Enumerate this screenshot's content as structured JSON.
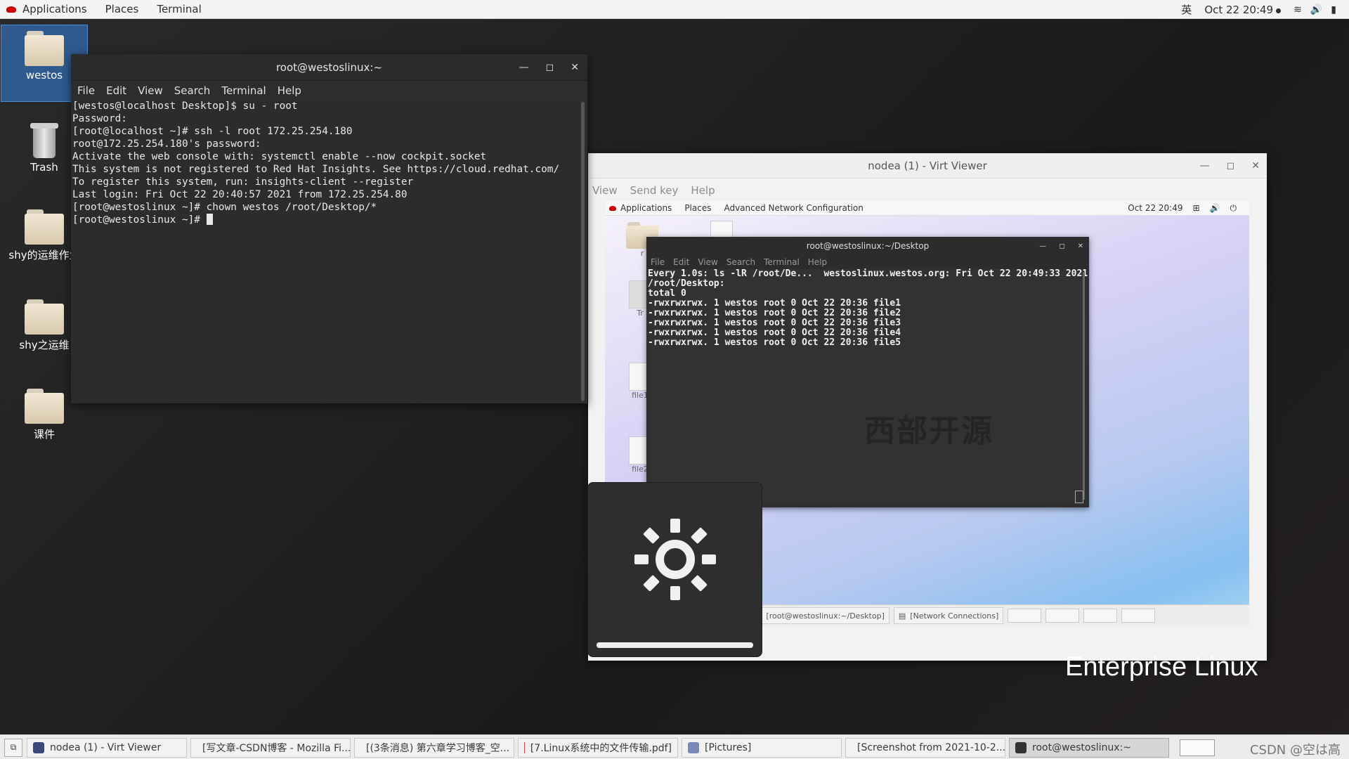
{
  "topbar": {
    "applications": "Applications",
    "places": "Places",
    "terminal": "Terminal",
    "lang": "英",
    "datetime": "Oct 22  20:49"
  },
  "desktop": {
    "icons": [
      {
        "label": "westos"
      },
      {
        "label": "Trash"
      },
      {
        "label": "shy的运维作业"
      },
      {
        "label": "shy之运维"
      },
      {
        "label": "课件"
      }
    ],
    "brand_text": "Enterprise Linux"
  },
  "terminal": {
    "title": "root@westoslinux:~",
    "menu": [
      "File",
      "Edit",
      "View",
      "Search",
      "Terminal",
      "Help"
    ],
    "lines": [
      "[westos@localhost Desktop]$ su - root",
      "Password:",
      "[root@localhost ~]# ssh -l root 172.25.254.180",
      "root@172.25.254.180's password:",
      "Activate the web console with: systemctl enable --now cockpit.socket",
      "",
      "This system is not registered to Red Hat Insights. See https://cloud.redhat.com/",
      "To register this system, run: insights-client --register",
      "",
      "Last login: Fri Oct 22 20:40:57 2021 from 172.25.254.80",
      "[root@westoslinux ~]# chown westos /root/Desktop/*",
      "[root@westoslinux ~]# "
    ]
  },
  "virt": {
    "title": "nodea (1) - Virt Viewer",
    "menu": [
      "View",
      "Send key",
      "Help"
    ],
    "guest": {
      "topbar": {
        "applications": "Applications",
        "places": "Places",
        "extra": "Advanced Network Configuration",
        "datetime": "Oct 22  20:49"
      },
      "icons": [
        "r",
        "Tr",
        "file1",
        "file2"
      ],
      "terminal": {
        "title": "root@westoslinux:~/Desktop",
        "menu": [
          "File",
          "Edit",
          "View",
          "Search",
          "Terminal",
          "Help"
        ],
        "lines": [
          "Every 1.0s: ls -lR /root/De...  westoslinux.westos.org: Fri Oct 22 20:49:33 2021",
          "",
          "/root/Desktop:",
          "total 0",
          "-rwxrwxrwx. 1 westos root 0 Oct 22 20:36 file1",
          "-rwxrwxrwx. 1 westos root 0 Oct 22 20:36 file2",
          "-rwxrwxrwx. 1 westos root 0 Oct 22 20:36 file3",
          "-rwxrwxrwx. 1 westos root 0 Oct 22 20:36 file4",
          "-rwxrwxrwx. 1 westos root 0 Oct 22 20:36 file5"
        ],
        "watermark": "西部开源"
      },
      "taskbar": [
        {
          "label": "[root@westoslinux:~/Desktop]"
        },
        {
          "label": "[Network Connections]"
        }
      ]
    }
  },
  "osd": {
    "brightness": 1.0
  },
  "taskbar": {
    "items": [
      {
        "label": "nodea (1) - Virt Viewer",
        "color": "#3a4a7a"
      },
      {
        "label": "[写文章-CSDN博客 - Mozilla Fi...",
        "color": "#e66000"
      },
      {
        "label": "[(3条消息) 第六章学习博客_空...",
        "color": "#e66000"
      },
      {
        "label": "[7.Linux系统中的文件传输.pdf]",
        "color": "#d44"
      },
      {
        "label": "[Pictures]",
        "color": "#7a8ab8"
      },
      {
        "label": "[Screenshot from 2021-10-2...",
        "color": "#888"
      },
      {
        "label": "root@westoslinux:~",
        "color": "#333"
      }
    ],
    "watermark": "CSDN @空は高"
  }
}
